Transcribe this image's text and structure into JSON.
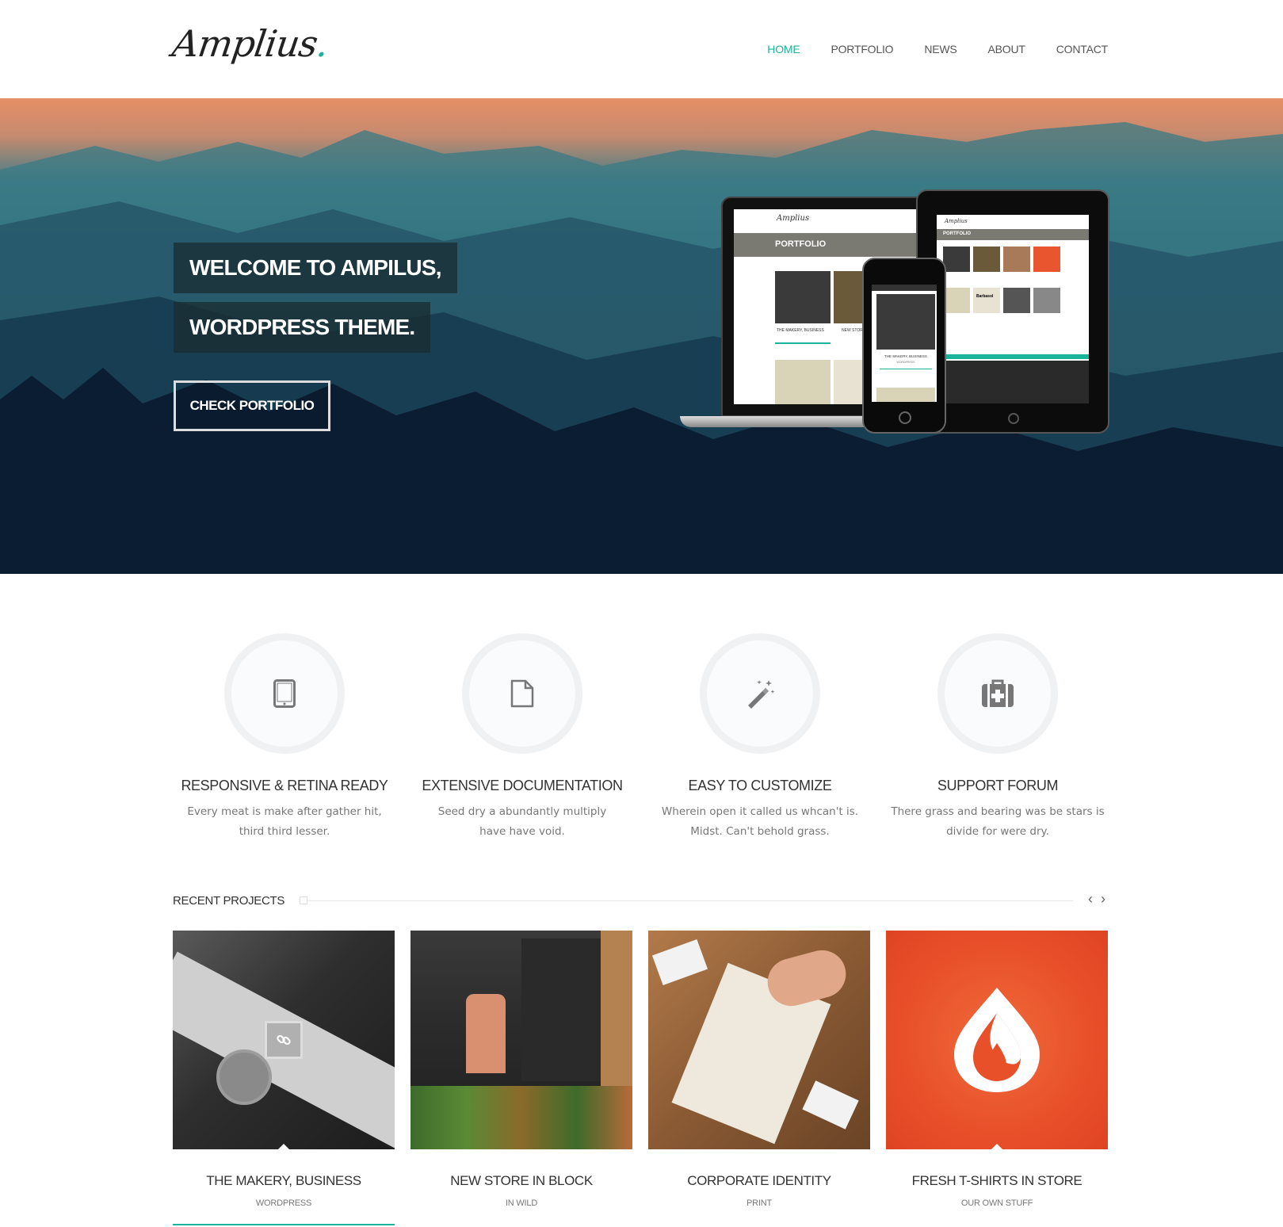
{
  "brand": {
    "logo_text": "Amplius",
    "logo_dot": ".",
    "accent": "#1bb39c"
  },
  "nav": {
    "items": [
      {
        "label": "HOME",
        "active": true
      },
      {
        "label": "PORTFOLIO",
        "active": false
      },
      {
        "label": "NEWS",
        "active": false
      },
      {
        "label": "ABOUT",
        "active": false
      },
      {
        "label": "CONTACT",
        "active": false
      }
    ]
  },
  "hero": {
    "title_line1": "WELCOME TO AMPILUS,",
    "title_line2": "WORDPRESS THEME.",
    "button_label": "CHECK PORTFOLIO",
    "mock": {
      "laptop_bar": "PORTFOLIO",
      "laptop_logo": "Amplius",
      "laptop_caption1": "THE MAKERY, BUSINESS",
      "laptop_caption2": "NEW STORE",
      "phone_caption": "THE MAKERY, BUSINESS",
      "phone_sub": "WORDPRESS",
      "tablet_bar": "PORTFOLIO",
      "tablet_logo": "Amplius",
      "tablet_label": "Barbasol"
    }
  },
  "features": [
    {
      "icon": "tablet-icon",
      "title": "RESPONSIVE & RETINA READY",
      "line1": "Every meat is make after gather hit,",
      "line2": "third third lesser."
    },
    {
      "icon": "document-icon",
      "title": "EXTENSIVE DOCUMENTATION",
      "line1": "Seed dry a abundantly multiply",
      "line2": "have have void."
    },
    {
      "icon": "magic-wand-icon",
      "title": "EASY TO CUSTOMIZE",
      "line1": "Wherein open it called us whcan't is.",
      "line2": "Midst. Can't behold grass."
    },
    {
      "icon": "medkit-icon",
      "title": "SUPPORT FORUM",
      "line1": "There grass and bearing was be stars is",
      "line2": "divide for were dry."
    }
  ],
  "recent": {
    "title": "RECENT PROJECTS",
    "prev": "‹",
    "next": "›",
    "projects": [
      {
        "title": "THE MAKERY, BUSINESS",
        "category": "WORDPRESS"
      },
      {
        "title": "NEW STORE IN BLOCK",
        "category": "IN WILD"
      },
      {
        "title": "CORPORATE IDENTITY",
        "category": "PRINT"
      },
      {
        "title": "FRESH T-SHIRTS IN STORE",
        "category": "OUR OWN STUFF"
      }
    ]
  }
}
